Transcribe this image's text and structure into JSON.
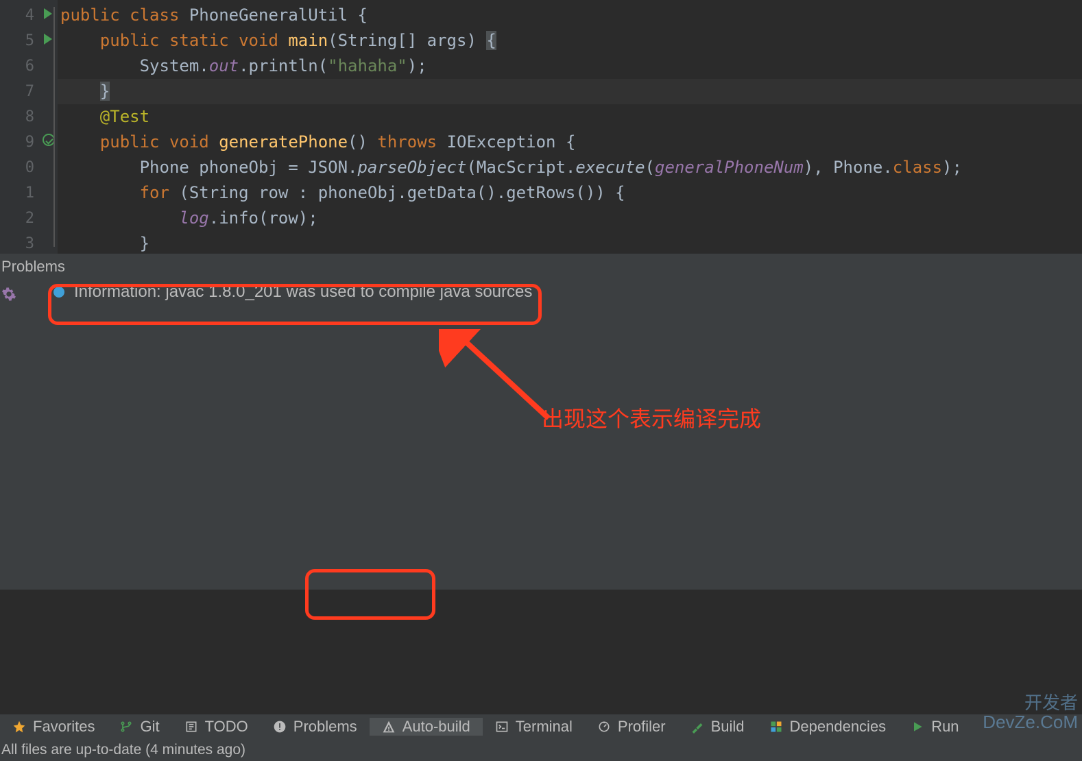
{
  "editor": {
    "lines": [
      {
        "n": "4",
        "icon": "run"
      },
      {
        "n": "5",
        "icon": "run"
      },
      {
        "n": "6",
        "icon": ""
      },
      {
        "n": "7",
        "icon": ""
      },
      {
        "n": "8",
        "icon": ""
      },
      {
        "n": "9",
        "icon": "check"
      },
      {
        "n": "0",
        "icon": ""
      },
      {
        "n": "1",
        "icon": ""
      },
      {
        "n": "2",
        "icon": ""
      },
      {
        "n": "3",
        "icon": ""
      }
    ],
    "code": {
      "l4": {
        "kw_public": "public",
        "kw_class": "class",
        "cls": "PhoneGeneralUtil",
        "brace": "{"
      },
      "l5": {
        "kw_public": "public",
        "kw_static": "static",
        "kw_void": "void",
        "mth": "main",
        "params": "(String[] args)",
        "brace": "{"
      },
      "l6": {
        "sys": "System.",
        "out": "out",
        "dot": ".println(",
        "str": "\"hahaha\"",
        "end": ");"
      },
      "l7": {
        "brace": "}"
      },
      "l8": {
        "ann": "@Test"
      },
      "l9": {
        "kw_public": "public",
        "kw_void": "void",
        "mth": "generatePhone",
        "paren": "()",
        "kw_throws": "throws",
        "exc": "IOException",
        "brace": "{"
      },
      "l10": {
        "pre": "Phone phoneObj = JSON.",
        "parse": "parseObject",
        "open": "(MacScript.",
        "exec": "execute",
        "open2": "(",
        "param": "generalPhoneNum",
        "close": "), Phone.",
        "kw_class2": "class",
        "end": ");"
      },
      "l11": {
        "kw_for": "for",
        "rest": " (String row : phoneObj.getData().getRows()) {"
      },
      "l12": {
        "log": "log",
        "rest": ".info(row);"
      },
      "l13": {
        "brace": "}"
      }
    }
  },
  "problems": {
    "title": "Problems",
    "info_text": "Information: javac 1.8.0_201 was used to compile java sources"
  },
  "annotation": {
    "text": "出现这个表示编译完成"
  },
  "tabs": {
    "favorites": "Favorites",
    "git": "Git",
    "todo": "TODO",
    "problems": "Problems",
    "autobuild": "Auto-build",
    "terminal": "Terminal",
    "profiler": "Profiler",
    "build": "Build",
    "dependencies": "Dependencies",
    "run": "Run"
  },
  "status": {
    "text": "All files are up-to-date (4 minutes ago)"
  },
  "watermark": {
    "l1": "开发者",
    "l2": "DevZe.CoM"
  }
}
